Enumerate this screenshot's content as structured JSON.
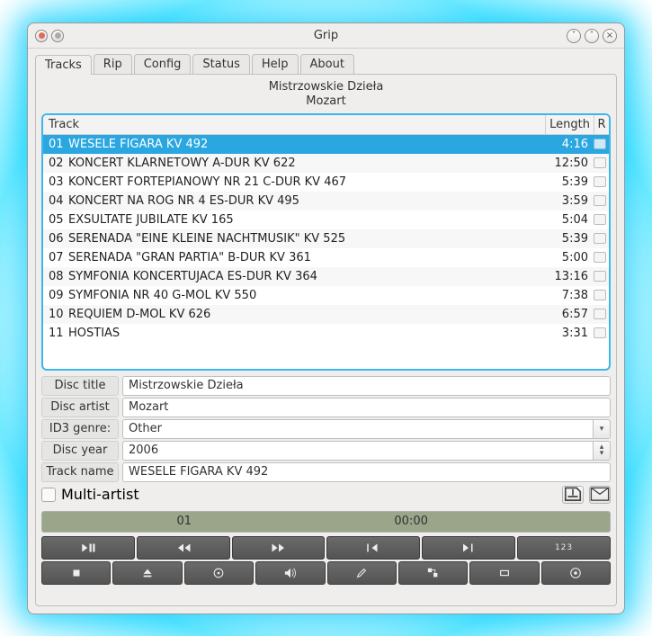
{
  "window": {
    "title": "Grip"
  },
  "tabs": [
    "Tracks",
    "Rip",
    "Config",
    "Status",
    "Help",
    "About"
  ],
  "active_tab": 0,
  "album": {
    "title": "Mistrzowskie Dzieła",
    "artist": "Mozart"
  },
  "columns": {
    "track": "Track",
    "length": "Length",
    "rip": "R"
  },
  "tracks": [
    {
      "n": "01",
      "name": "WESELE FIGARA KV 492",
      "len": "4:16",
      "sel": true
    },
    {
      "n": "02",
      "name": "KONCERT KLARNETOWY A-DUR KV 622",
      "len": "12:50"
    },
    {
      "n": "03",
      "name": "KONCERT FORTEPIANOWY NR 21 C-DUR KV 467",
      "len": "5:39"
    },
    {
      "n": "04",
      "name": "KONCERT NA RÓG NR 4 ES-DUR KV 495",
      "len": "3:59"
    },
    {
      "n": "05",
      "name": "EXSULTATE JUBILATE KV 165",
      "len": "5:04"
    },
    {
      "n": "06",
      "name": "SERENADA \"EINE KLEINE NACHTMUSIK\" KV 525",
      "len": "5:39"
    },
    {
      "n": "07",
      "name": "SERENADA \"GRAN PARTIA\" B-DUR KV 361",
      "len": "5:00"
    },
    {
      "n": "08",
      "name": "SYMFONIA KONCERTUJACA ES-DUR KV 364",
      "len": "13:16"
    },
    {
      "n": "09",
      "name": "SYMFONIA NR 40 G-MOL KV 550",
      "len": "7:38"
    },
    {
      "n": "10",
      "name": "REQUIEM D-MOL KV 626",
      "len": "6:57"
    },
    {
      "n": "11",
      "name": "HOSTIAS",
      "len": "3:31"
    }
  ],
  "form": {
    "labels": {
      "title": "Disc title",
      "artist": "Disc artist",
      "genre": "ID3 genre:",
      "year": "Disc year",
      "track": "Track name",
      "multi": "Multi-artist"
    },
    "values": {
      "title": "Mistrzowskie Dzieła",
      "artist": "Mozart",
      "genre": "Other",
      "year": "2006",
      "track": "WESELE FIGARA KV 492"
    }
  },
  "progress": {
    "track": "01",
    "time": "00:00"
  },
  "buttons": {
    "abc": "123"
  }
}
